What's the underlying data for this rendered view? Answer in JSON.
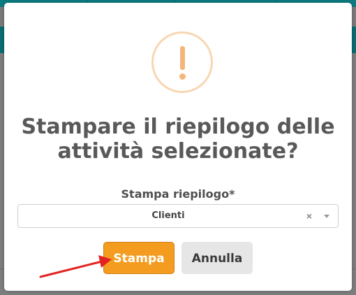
{
  "dialog": {
    "title_line1": "Stampare il riepilogo delle",
    "title_line2": "attività selezionate?",
    "icon": "warning-exclamation-icon",
    "field_label": "Stampa riepilogo*",
    "select": {
      "value": "Clienti",
      "clear_glyph": "×"
    },
    "confirm_label": "Stampa",
    "cancel_label": "Annulla"
  },
  "colors": {
    "confirm": "#f39c1f",
    "cancel": "#e6e6e6",
    "warning": "#f4b67b",
    "annotation_arrow": "#e32222",
    "background_brand": "#0b7c82"
  }
}
